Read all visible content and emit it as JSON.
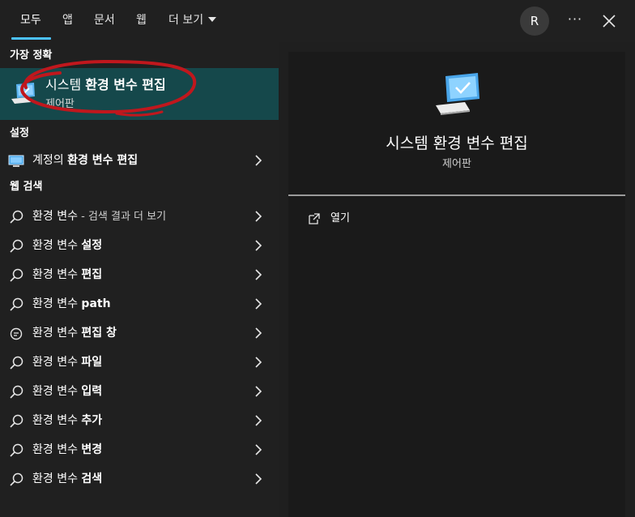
{
  "tabs": [
    {
      "label": "모두"
    },
    {
      "label": "앱"
    },
    {
      "label": "문서"
    },
    {
      "label": "웹"
    },
    {
      "label": "더 보기"
    }
  ],
  "user_initial": "R",
  "more_label": "···",
  "sections": {
    "best_match": "가장 정확",
    "settings": "설정",
    "web": "웹 검색"
  },
  "best": {
    "title_prefix": "시스템 ",
    "title_bold": "환경 변수 편집",
    "subtitle": "제어판"
  },
  "settings_item": {
    "prefix": "계정의 ",
    "bold": "환경 변수 편집"
  },
  "web_items": [
    {
      "prefix": "환경 변수",
      "suffix": " - 검색 결과 더 보기",
      "icon": "search-icon"
    },
    {
      "prefix": "환경 변수 ",
      "bold": "설정",
      "icon": "search-icon"
    },
    {
      "prefix": "환경 변수 ",
      "bold": "편집",
      "icon": "search-icon"
    },
    {
      "prefix": "환경 변수 ",
      "bold": "path",
      "icon": "search-icon"
    },
    {
      "prefix": "환경 변수 ",
      "bold": "편집 창",
      "icon": "chat-search-icon"
    },
    {
      "prefix": "환경 변수 ",
      "bold": "파일",
      "icon": "search-icon"
    },
    {
      "prefix": "환경 변수 ",
      "bold": "입력",
      "icon": "search-icon"
    },
    {
      "prefix": "환경 변수 ",
      "bold": "추가",
      "icon": "search-icon"
    },
    {
      "prefix": "환경 변수 ",
      "bold": "변경",
      "icon": "search-icon"
    },
    {
      "prefix": "환경 변수 ",
      "bold": "검색",
      "icon": "search-icon"
    }
  ],
  "detail": {
    "title": "시스템 환경 변수 편집",
    "subtitle": "제어판",
    "action_open": "열기"
  },
  "colors": {
    "accent": "#4cc2ff",
    "highlight": "#15484b",
    "annotation": "#c0171d"
  }
}
